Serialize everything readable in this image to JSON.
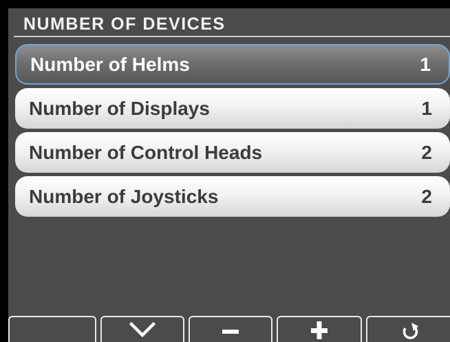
{
  "header": {
    "title": "NUMBER OF DEVICES"
  },
  "menu": {
    "items": [
      {
        "label": "Number of Helms",
        "value": "1",
        "selected": true
      },
      {
        "label": "Number of Displays",
        "value": "1",
        "selected": false
      },
      {
        "label": "Number of Control Heads",
        "value": "2",
        "selected": false
      },
      {
        "label": "Number of Joysticks",
        "value": "2",
        "selected": false
      }
    ]
  },
  "softkeys": [
    {
      "icon": "blank"
    },
    {
      "icon": "chevron-down-icon"
    },
    {
      "icon": "minus-icon"
    },
    {
      "icon": "plus-icon"
    },
    {
      "icon": "back-icon"
    }
  ],
  "colors": {
    "screen_background": "#4b4b4b",
    "selection_border": "#6fa6d8",
    "title_text": "#f2f2f2"
  }
}
